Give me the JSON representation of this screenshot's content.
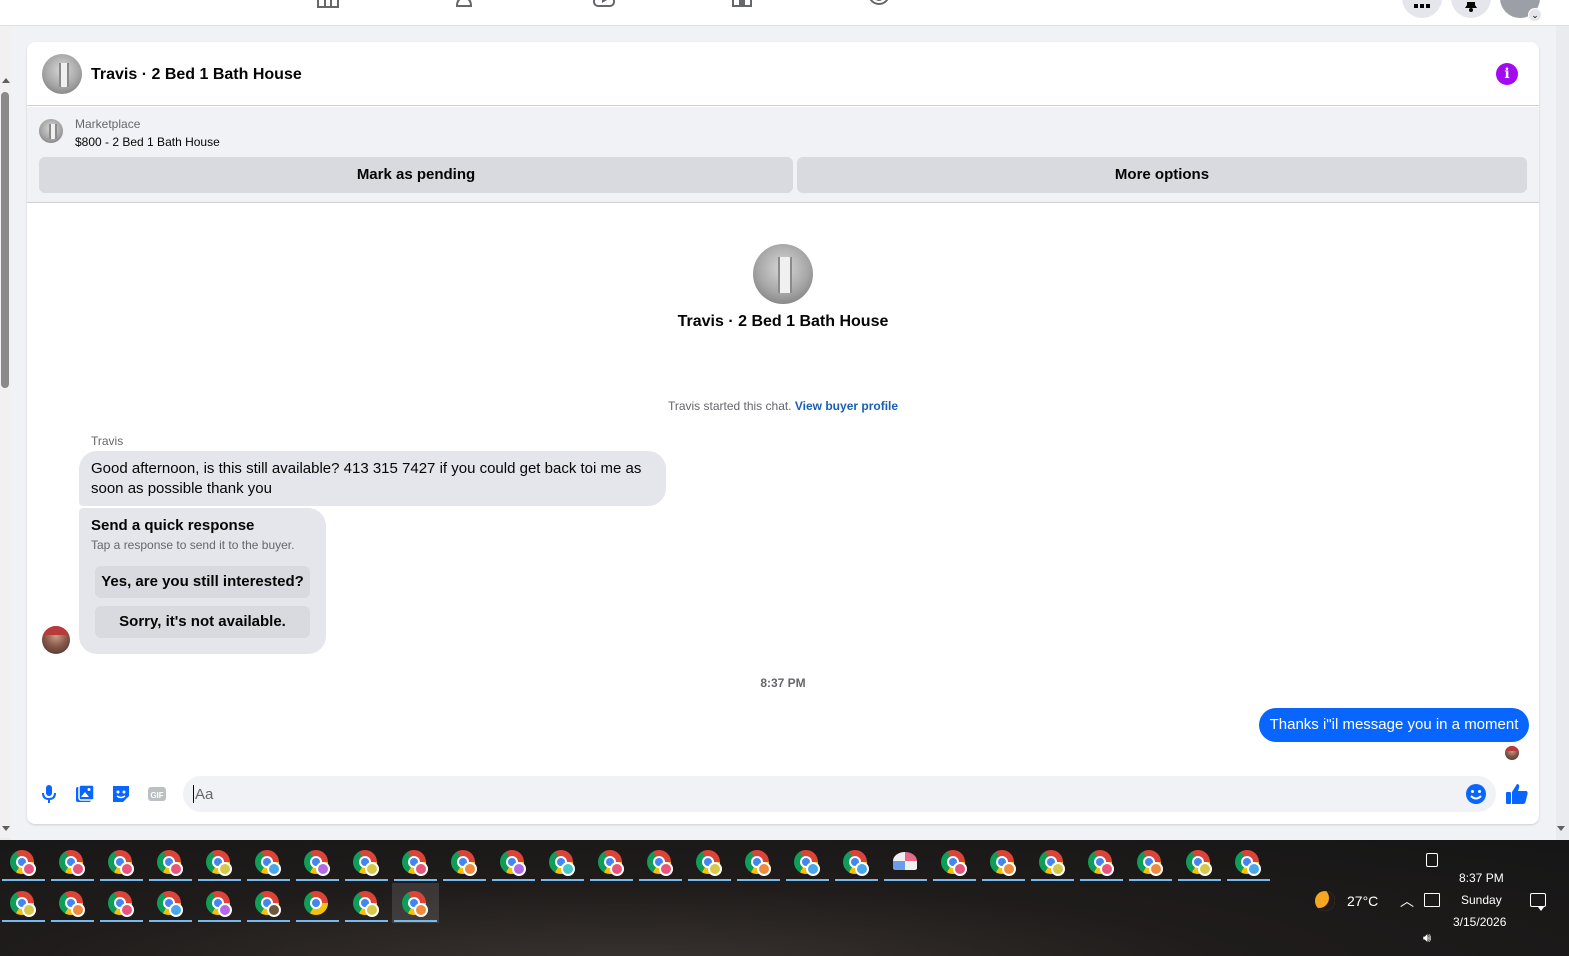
{
  "header": {
    "title": "Travis · 2 Bed 1 Bath House",
    "info_icon": "info-icon"
  },
  "marketplace": {
    "label": "Marketplace",
    "listing": "$800 - 2 Bed 1 Bath House",
    "mark_pending": "Mark as pending",
    "more_options": "More options"
  },
  "conversation": {
    "title": "Travis · 2 Bed 1 Bath House",
    "started_text": "Travis started this chat.",
    "view_buyer_profile": "View buyer profile",
    "sender_name": "Travis",
    "incoming_message": "Good afternoon, is this still available? 413 315 7427 if you could get back toi me as soon as possible thank you",
    "quick_response": {
      "title": "Send a quick response",
      "subtitle": "Tap a response to send it to the buyer.",
      "options": [
        "Yes, are you still interested?",
        "Sorry, it's not available."
      ]
    },
    "timestamp": "8:37 PM",
    "outgoing_message": "Thanks i\"il message you in a moment"
  },
  "composer": {
    "placeholder": "Aa",
    "icons": [
      "microphone-icon",
      "photo-icon",
      "sticker-icon",
      "gif-icon",
      "emoji-icon",
      "thumbs-up-icon"
    ],
    "gif_label": "GIF"
  },
  "colors": {
    "accent_blue": "#0866ff",
    "info_purple": "#a30aed",
    "link_blue": "#1a5fb4"
  },
  "taskbar": {
    "row1_badges": [
      "#e8547a",
      "#e8547a",
      "#e8547a",
      "#e8547a",
      "#d7c84a",
      "#4aa8e8",
      "#b46ae8",
      "#d7c84a",
      "#e8547a",
      "#f08a3c",
      "#b46ae8",
      "#4ac8c8",
      "#e8547a",
      "#e8547a",
      "#d7c84a",
      "#f08a3c",
      "#4aa8e8",
      "#4aa8e8",
      null,
      "#e8547a",
      "#f08a3c",
      "#d7c84a",
      "#e8547a",
      "#f08a3c",
      "#d7c84a",
      "#4aa8e8"
    ],
    "row2_badges": [
      "#d7c84a",
      "#f08a3c",
      "#e8547a",
      "#4aa8e8",
      "#b46ae8",
      null,
      null,
      "#d7c84a",
      "#f08a3c"
    ],
    "weather_temp": "27°C",
    "clock_time": "8:37 PM",
    "clock_day": "Sunday",
    "clock_date": "3/15/2026"
  }
}
